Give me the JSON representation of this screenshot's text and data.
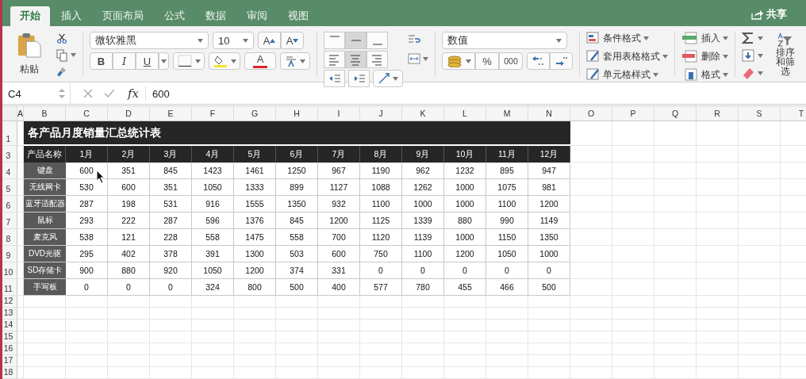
{
  "tabs": [
    {
      "label": "开始",
      "selected": true
    },
    {
      "label": "插入",
      "selected": false
    },
    {
      "label": "页面布局",
      "selected": false
    },
    {
      "label": "公式",
      "selected": false
    },
    {
      "label": "数据",
      "selected": false
    },
    {
      "label": "审阅",
      "selected": false
    },
    {
      "label": "视图",
      "selected": false
    }
  ],
  "share": "共享",
  "clipboard": {
    "paste": "粘贴"
  },
  "font": {
    "name": "微软雅黑",
    "size": "10",
    "grow": "A",
    "shrink": "A",
    "bold": "B",
    "italic": "I",
    "underline": "U",
    "font_color_label": "A"
  },
  "alignment": {
    "vertical": [
      {
        "kind": "top",
        "selected": false
      },
      {
        "kind": "middle",
        "selected": true
      },
      {
        "kind": "bottom",
        "selected": false
      }
    ],
    "horizontal": [
      {
        "kind": "left",
        "selected": false
      },
      {
        "kind": "center",
        "selected": true
      },
      {
        "kind": "right",
        "selected": false
      }
    ]
  },
  "number": {
    "format": "数值",
    "percent": "%",
    "thousands": "000"
  },
  "styles": [
    "条件格式",
    "套用表格格式",
    "单元格样式"
  ],
  "cells": [
    "插入",
    "删除",
    "格式"
  ],
  "editing": {
    "sort": "排序和筛选"
  },
  "formula_bar": {
    "cell": "C4",
    "fx": "fx",
    "value": "600"
  },
  "sheet": {
    "columns": [
      "A",
      "B",
      "C",
      "D",
      "E",
      "F",
      "G",
      "H",
      "I",
      "J",
      "K",
      "L",
      "M",
      "N",
      "O",
      "P",
      "Q",
      "R",
      "S",
      "T"
    ],
    "title_row": "1",
    "title": "各产品月度销量汇总统计表",
    "header_row": "3",
    "header": [
      "产品名称",
      "1月",
      "2月",
      "3月",
      "4月",
      "5月",
      "6月",
      "7月",
      "8月",
      "9月",
      "10月",
      "11月",
      "12月"
    ],
    "rows": [
      {
        "row": "4",
        "product": "键盘",
        "values": [
          "600",
          "351",
          "845",
          "1423",
          "1461",
          "1250",
          "967",
          "1190",
          "962",
          "1232",
          "895",
          "947"
        ]
      },
      {
        "row": "5",
        "product": "无线网卡",
        "values": [
          "530",
          "600",
          "351",
          "1050",
          "1333",
          "899",
          "1127",
          "1088",
          "1262",
          "1000",
          "1075",
          "981"
        ]
      },
      {
        "row": "6",
        "product": "蓝牙适配器",
        "values": [
          "287",
          "198",
          "531",
          "916",
          "1555",
          "1350",
          "932",
          "1100",
          "1000",
          "1000",
          "1100",
          "1200"
        ]
      },
      {
        "row": "7",
        "product": "鼠标",
        "values": [
          "293",
          "222",
          "287",
          "596",
          "1376",
          "845",
          "1200",
          "1125",
          "1339",
          "880",
          "990",
          "1149"
        ]
      },
      {
        "row": "8",
        "product": "麦克风",
        "values": [
          "538",
          "121",
          "228",
          "558",
          "1475",
          "558",
          "700",
          "1120",
          "1139",
          "1000",
          "1150",
          "1350"
        ]
      },
      {
        "row": "9",
        "product": "DVD光驱",
        "values": [
          "295",
          "402",
          "378",
          "391",
          "1300",
          "503",
          "600",
          "750",
          "1100",
          "1200",
          "1050",
          "1000"
        ]
      },
      {
        "row": "10",
        "product": "SD存储卡",
        "values": [
          "900",
          "880",
          "920",
          "1050",
          "1200",
          "374",
          "331",
          "0",
          "0",
          "0",
          "0",
          "0"
        ]
      },
      {
        "row": "11",
        "product": "手写板",
        "values": [
          "0",
          "0",
          "0",
          "324",
          "800",
          "500",
          "400",
          "577",
          "780",
          "455",
          "466",
          "500"
        ]
      }
    ],
    "empty_rows": [
      "12",
      "13",
      "14",
      "15",
      "16",
      "17",
      "18"
    ]
  }
}
